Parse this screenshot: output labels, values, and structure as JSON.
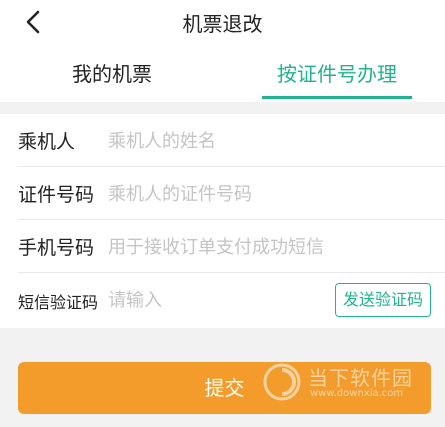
{
  "header": {
    "back_icon": "chevron-left-icon",
    "title": "机票退改"
  },
  "tabs": [
    {
      "label": "我的机票",
      "active": false
    },
    {
      "label": "按证件号办理",
      "active": true
    }
  ],
  "form": {
    "passenger": {
      "label": "乘机人",
      "placeholder": "乘机人的姓名"
    },
    "id_number": {
      "label": "证件号码",
      "placeholder": "乘机人的证件号码"
    },
    "phone": {
      "label": "手机号码",
      "placeholder": "用于接收订单支付成功短信"
    },
    "sms_code": {
      "label": "短信验证码",
      "placeholder": "请输入",
      "send_button": "发送验证码"
    }
  },
  "submit_label": "提交",
  "watermark": {
    "text": "当下软件园",
    "url": "www.downxia.com"
  },
  "colors": {
    "accent": "#1fb48e",
    "submit": "#f39c2c",
    "background_grey": "#f2f2f2"
  }
}
